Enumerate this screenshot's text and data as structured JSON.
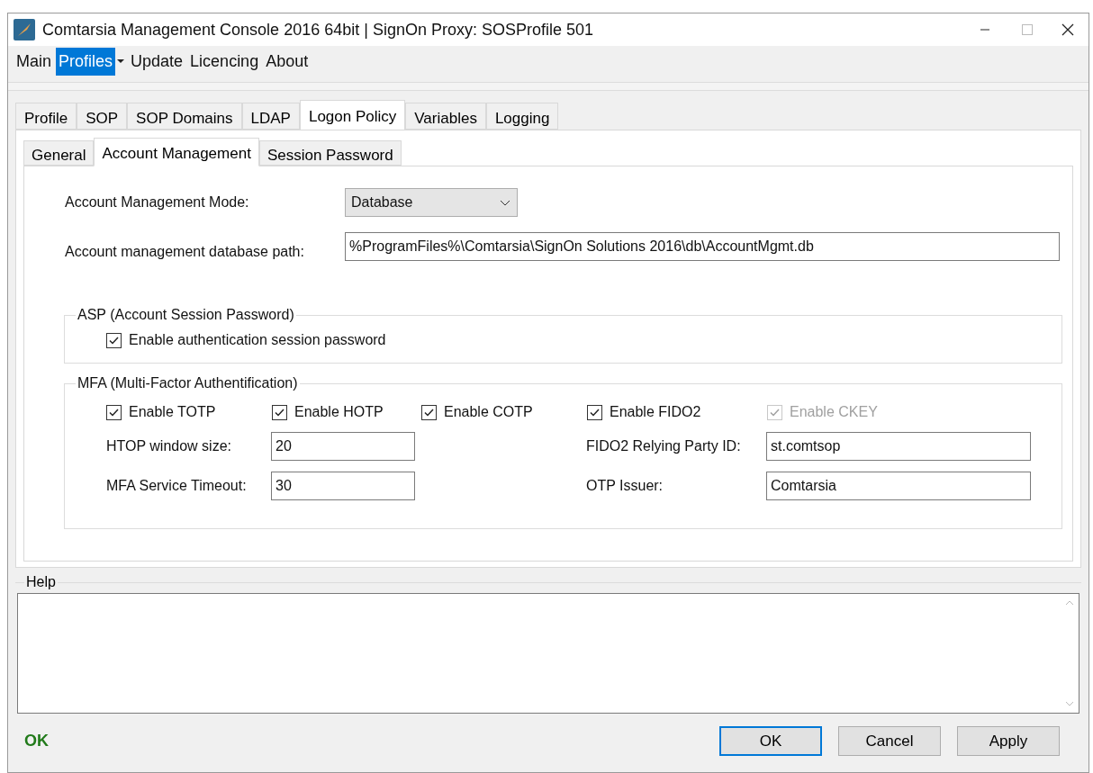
{
  "window": {
    "title": "Comtarsia Management Console 2016 64bit | SignOn Proxy: SOSProfile 501"
  },
  "menu": [
    {
      "label": "Main",
      "selected": false,
      "dropdown": false
    },
    {
      "label": "Profiles",
      "selected": true,
      "dropdown": true
    },
    {
      "label": "Update",
      "selected": false,
      "dropdown": false
    },
    {
      "label": "Licencing",
      "selected": false,
      "dropdown": false
    },
    {
      "label": "About",
      "selected": false,
      "dropdown": false
    }
  ],
  "tabs": [
    {
      "label": "Profile",
      "selected": false
    },
    {
      "label": "SOP",
      "selected": false
    },
    {
      "label": "SOP Domains",
      "selected": false
    },
    {
      "label": "LDAP",
      "selected": false
    },
    {
      "label": "Logon Policy",
      "selected": true
    },
    {
      "label": "Variables",
      "selected": false
    },
    {
      "label": "Logging",
      "selected": false
    }
  ],
  "subtabs": [
    {
      "label": "General",
      "selected": false
    },
    {
      "label": "Account Management",
      "selected": true
    },
    {
      "label": "Session Password",
      "selected": false
    }
  ],
  "mode": {
    "label": "Account Management Mode:",
    "value": "Database"
  },
  "db_path": {
    "label": "Account management database path:",
    "value": "%ProgramFiles%\\Comtarsia\\SignOn Solutions 2016\\db\\AccountMgmt.db"
  },
  "asp": {
    "title": "ASP (Account Session Password)",
    "checkbox": {
      "label": "Enable authentication session password",
      "checked": true,
      "disabled": false
    }
  },
  "mfa": {
    "title": "MFA (Multi-Factor Authentification)",
    "checkboxes": [
      {
        "label": "Enable TOTP",
        "checked": true,
        "disabled": false
      },
      {
        "label": "Enable HOTP",
        "checked": true,
        "disabled": false
      },
      {
        "label": "Enable COTP",
        "checked": true,
        "disabled": false
      },
      {
        "label": "Enable FIDO2",
        "checked": true,
        "disabled": false
      },
      {
        "label": "Enable CKEY",
        "checked": true,
        "disabled": true
      }
    ],
    "fields_left": [
      {
        "label": "HTOP window size:",
        "value": "20"
      },
      {
        "label": "MFA Service Timeout:",
        "value": "30"
      }
    ],
    "fields_right": [
      {
        "label": "FIDO2 Relying Party ID:",
        "value": "st.comtsop"
      },
      {
        "label": "OTP Issuer:",
        "value": "Comtarsia"
      }
    ]
  },
  "help": {
    "title": "Help"
  },
  "status": "OK",
  "buttons": [
    {
      "label": "OK",
      "selected": true
    },
    {
      "label": "Cancel",
      "selected": false
    },
    {
      "label": "Apply",
      "selected": false
    }
  ]
}
